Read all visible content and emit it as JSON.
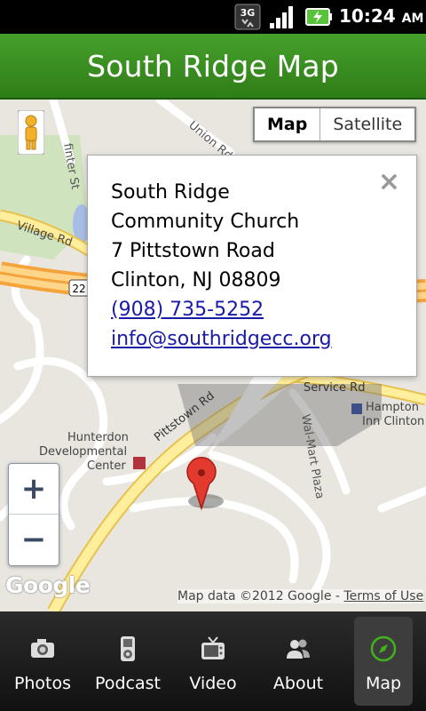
{
  "status_bar": {
    "network": "3G",
    "time": "10:24",
    "ampm": "AM"
  },
  "title": "South Ridge Map",
  "map": {
    "type_buttons": [
      "Map",
      "Satellite"
    ],
    "selected_type": "Map",
    "streets": [
      "Union Rd",
      "Village Rd",
      "22",
      "Pittstown Rd",
      "Service Rd",
      "Wal-Mart Plaza",
      "finter St",
      "Hunterdon Developmental Center",
      "Hampton Inn Clinton"
    ],
    "zoom_in": "+",
    "zoom_out": "−",
    "logo": "Google",
    "attribution": "Map data ©2012 Google",
    "separator": "-",
    "terms": "Terms of Use"
  },
  "info_window": {
    "name_line1": "South Ridge",
    "name_line2": "Community Church",
    "address": "7 Pittstown Road",
    "city": "Clinton, NJ 08809",
    "phone": "(908) 735-5252",
    "email": "info@southridgecc.org",
    "close": "×"
  },
  "tabs": [
    {
      "label": "Photos",
      "icon": "camera-icon"
    },
    {
      "label": "Podcast",
      "icon": "ipod-icon"
    },
    {
      "label": "Video",
      "icon": "tv-icon"
    },
    {
      "label": "About",
      "icon": "people-icon"
    },
    {
      "label": "Map",
      "icon": "compass-icon"
    }
  ],
  "active_tab": "Map"
}
